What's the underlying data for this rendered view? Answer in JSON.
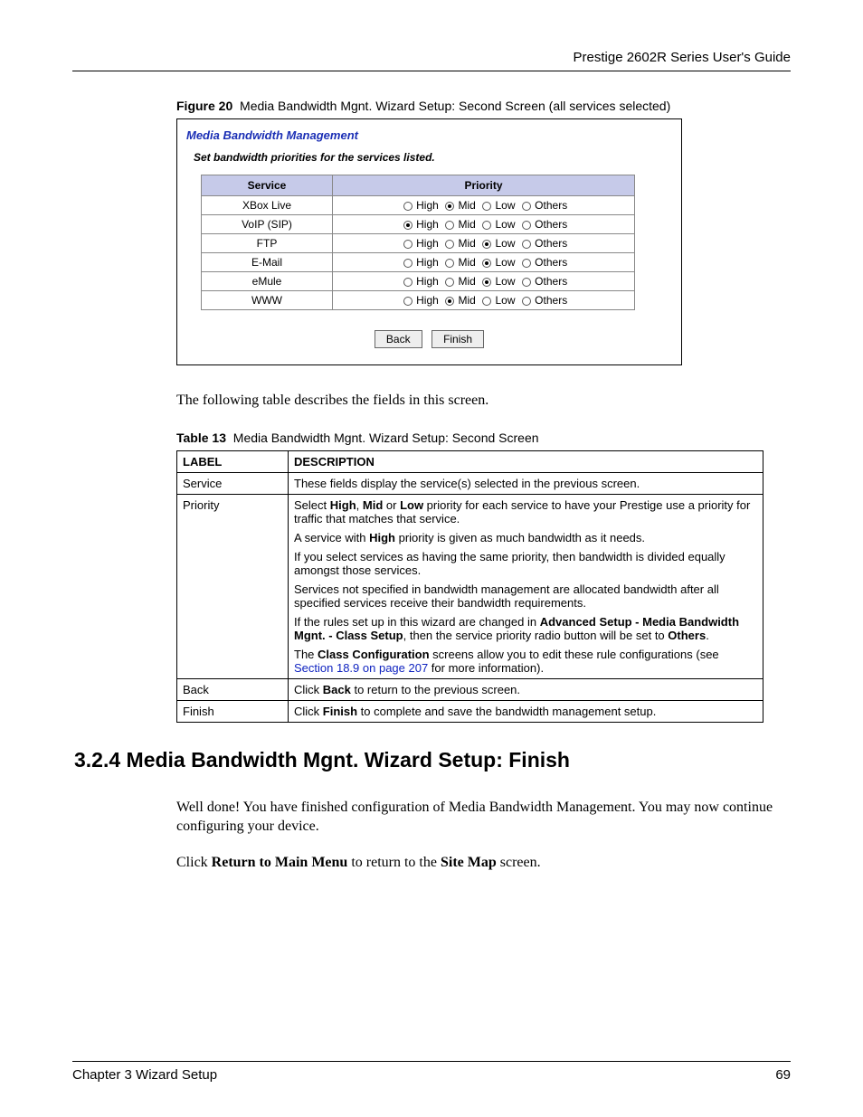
{
  "header": {
    "title": "Prestige 2602R Series User's Guide"
  },
  "figure": {
    "label": "Figure 20",
    "caption": "Media Bandwidth Mgnt. Wizard Setup: Second Screen (all services selected)"
  },
  "wizard": {
    "title": "Media Bandwidth Management",
    "note": "Set bandwidth priorities for the services listed.",
    "cols": {
      "service": "Service",
      "priority": "Priority"
    },
    "options": {
      "high": "High",
      "mid": "Mid",
      "low": "Low",
      "others": "Others"
    },
    "rows": [
      {
        "service": "XBox Live",
        "selected": "mid"
      },
      {
        "service": "VoIP (SIP)",
        "selected": "high"
      },
      {
        "service": "FTP",
        "selected": "low"
      },
      {
        "service": "E-Mail",
        "selected": "low"
      },
      {
        "service": "eMule",
        "selected": "low"
      },
      {
        "service": "WWW",
        "selected": "mid"
      }
    ],
    "buttons": {
      "back": "Back",
      "finish": "Finish"
    }
  },
  "para1": "The following table describes the fields in this screen.",
  "table": {
    "label": "Table 13",
    "caption": "Media Bandwidth Mgnt. Wizard Setup: Second Screen",
    "head": {
      "label": "LABEL",
      "desc": "DESCRIPTION"
    },
    "rows": {
      "service": {
        "label": "Service",
        "desc": "These fields display the service(s) selected in the previous screen."
      },
      "priority": {
        "label": "Priority",
        "p1a": "Select ",
        "p1b": "High",
        "p1c": ", ",
        "p1d": "Mid",
        "p1e": " or ",
        "p1f": "Low",
        "p1g": " priority for each service to have your Prestige use a priority for traffic that matches that service.",
        "p2a": "A service with ",
        "p2b": "High",
        "p2c": " priority is given as much bandwidth as it needs.",
        "p3": "If you select services as having the same priority, then bandwidth is divided equally amongst those services.",
        "p4": "Services not specified in bandwidth management are allocated bandwidth after all specified services receive their bandwidth requirements.",
        "p5a": "If the rules set up in this wizard are changed in ",
        "p5b": "Advanced Setup - Media Bandwidth Mgnt. - Class Setup",
        "p5c": ", then the service priority radio button will be set to ",
        "p5d": "Others",
        "p5e": ".",
        "p6a": "The ",
        "p6b": "Class Configuration",
        "p6c": " screens allow you to edit these rule configurations (see ",
        "p6link": "Section 18.9 on page 207",
        "p6d": " for more information)."
      },
      "back": {
        "label": "Back",
        "a": "Click ",
        "b": "Back",
        "c": " to return to the previous screen."
      },
      "finish": {
        "label": "Finish",
        "a": "Click ",
        "b": "Finish",
        "c": " to complete and save the bandwidth management setup."
      }
    }
  },
  "section": {
    "heading": "3.2.4  Media Bandwidth Mgnt. Wizard Setup: Finish",
    "p1": "Well done! You have finished configuration of Media Bandwidth Management. You may now continue configuring your device.",
    "p2a": "Click ",
    "p2b": "Return to Main Menu",
    "p2c": " to return to the ",
    "p2d": "Site Map",
    "p2e": " screen."
  },
  "footer": {
    "left": "Chapter 3 Wizard Setup",
    "right": "69"
  }
}
